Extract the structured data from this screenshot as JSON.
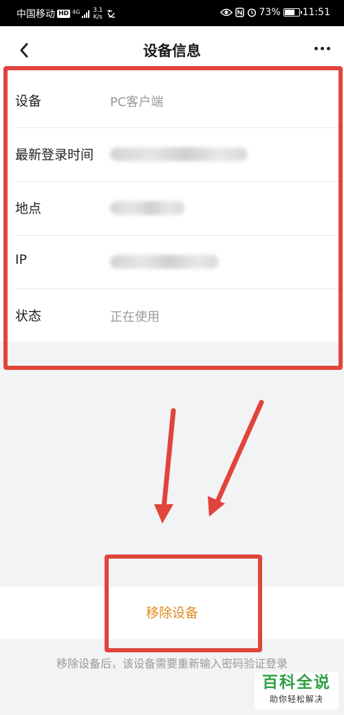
{
  "status_bar": {
    "carrier": "中国移动",
    "hd": "HD",
    "network": "4G",
    "speed_value": "3.1",
    "speed_unit": "K/s",
    "battery": "73%",
    "battery_level": 0.73,
    "time": "11:51"
  },
  "nav": {
    "title": "设备信息"
  },
  "info": {
    "rows": [
      {
        "label": "设备",
        "value": "PC客户端"
      },
      {
        "label": "最新登录时间",
        "value": ""
      },
      {
        "label": "地点",
        "value": ""
      },
      {
        "label": "IP",
        "value": ""
      },
      {
        "label": "状态",
        "value": "正在使用"
      }
    ]
  },
  "actions": {
    "remove_label": "移除设备",
    "remove_color": "#e08a1e",
    "hint": "移除设备后，该设备需要重新输入密码验证登录"
  },
  "annotation": {
    "color": "#e0443a"
  },
  "watermark": {
    "title": "百科全说",
    "subtitle": "助你轻松解决"
  }
}
